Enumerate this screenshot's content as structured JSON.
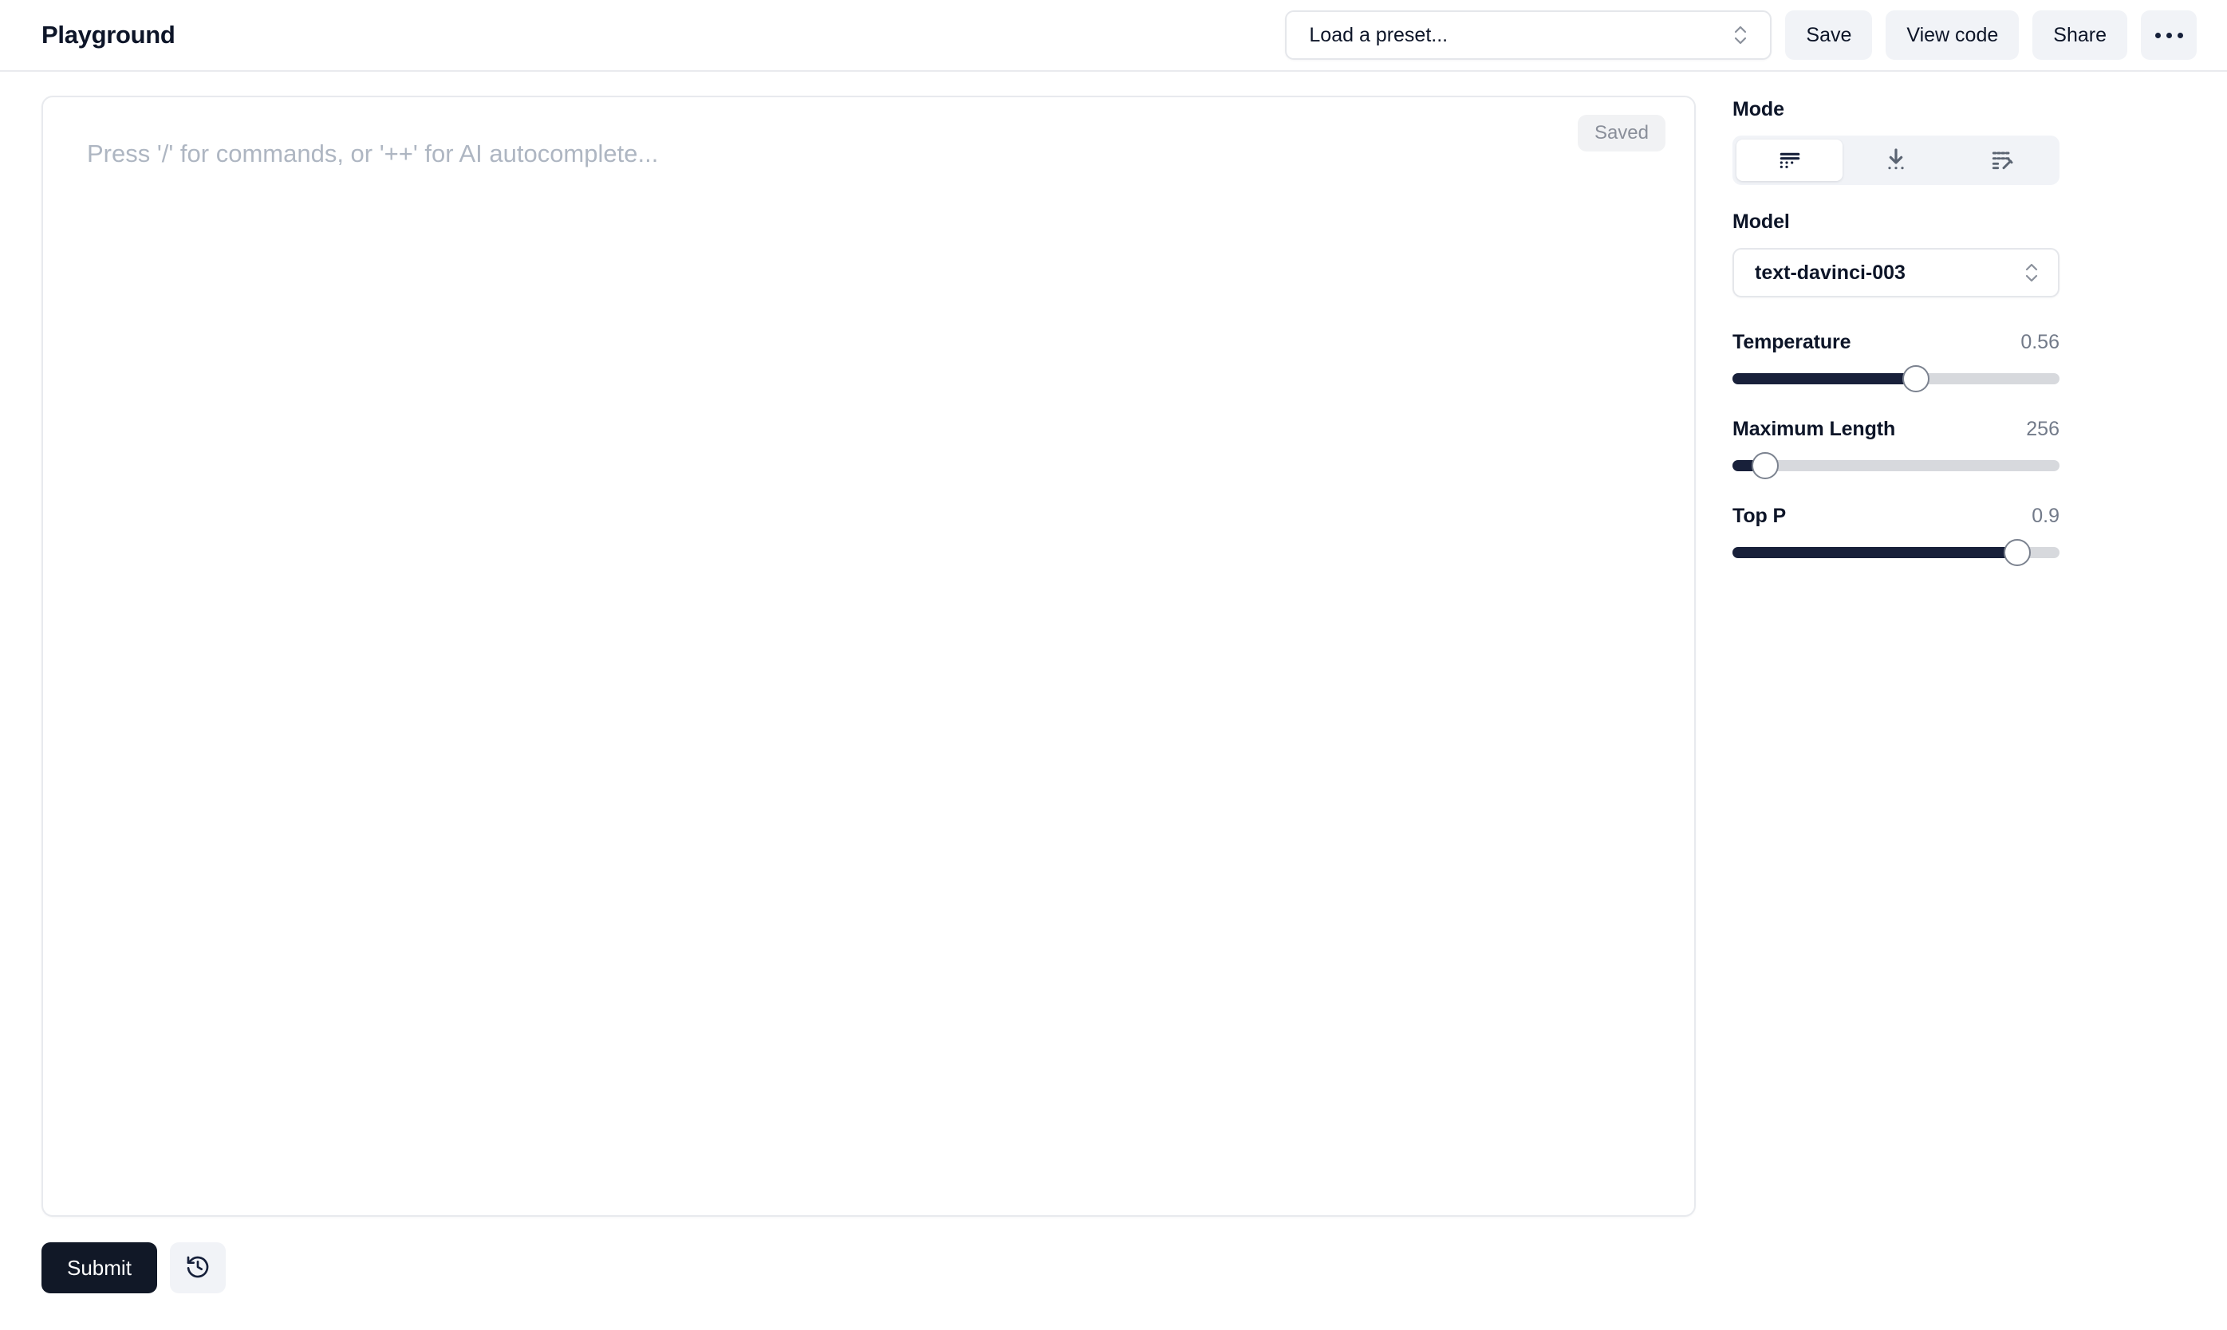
{
  "header": {
    "title": "Playground",
    "preset": {
      "value": "Load a preset...",
      "icon": "chevrons-up-down-icon"
    },
    "buttons": [
      {
        "label": "Save",
        "name": "save-button"
      },
      {
        "label": "View code",
        "name": "view-code-button"
      },
      {
        "label": "Share",
        "name": "share-button"
      }
    ],
    "more_menu": {
      "label": "...",
      "icon": "ellipsis-horizontal-icon"
    }
  },
  "editor": {
    "placeholder": "Press '/' for commands, or '++' for AI autocomplete...",
    "value": "",
    "status_badge": "Saved"
  },
  "actions": {
    "submit_label": "Submit",
    "history_icon": "history-clock-icon"
  },
  "sidebar": {
    "mode": {
      "label": "Mode",
      "options": [
        {
          "name": "mode-complete",
          "icon": "lines-dots-icon",
          "selected": true
        },
        {
          "name": "mode-insert",
          "icon": "download-arrow-dots-icon",
          "selected": false
        },
        {
          "name": "mode-edit",
          "icon": "lines-pencil-icon",
          "selected": false
        }
      ]
    },
    "model": {
      "label": "Model",
      "value": "text-davinci-003",
      "icon": "chevrons-up-down-icon"
    },
    "sliders": [
      {
        "name": "temperature",
        "label": "Temperature",
        "value": "0.56",
        "percent": 56
      },
      {
        "name": "maximum-length",
        "label": "Maximum Length",
        "value": "256",
        "percent": 10
      },
      {
        "name": "top-p",
        "label": "Top P",
        "value": "0.9",
        "percent": 87
      }
    ]
  },
  "colors": {
    "accent_dark": "#18203a",
    "button_bg": "#f1f3f7",
    "text_primary": "#0d1528",
    "text_muted": "#727a89",
    "border": "#e5e7eb"
  }
}
